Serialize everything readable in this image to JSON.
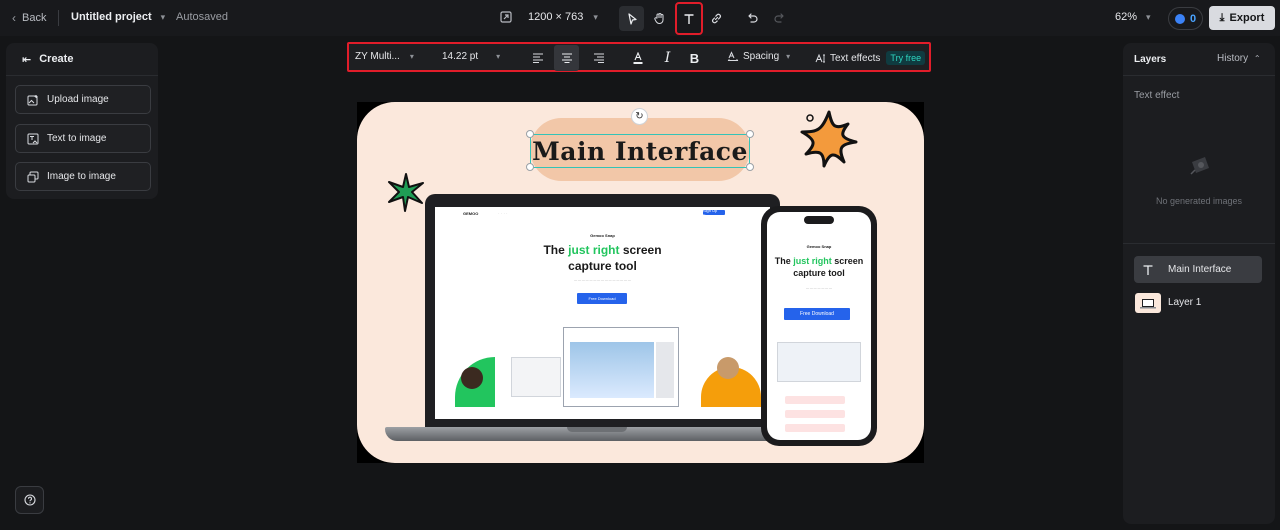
{
  "topbar": {
    "back_label": "Back",
    "project_name": "Untitled project",
    "autosaved": "Autosaved",
    "canvas_size": "1200 × 763",
    "zoom": "62%",
    "credits": "0",
    "export_label": "Export"
  },
  "left_panel": {
    "title": "Create",
    "buttons": [
      {
        "label": "Upload image"
      },
      {
        "label": "Text to image"
      },
      {
        "label": "Image to image"
      }
    ]
  },
  "text_toolbar": {
    "font": "ZY Multi...",
    "font_size": "14.22 pt",
    "spacing_label": "Spacing",
    "text_effects_label": "Text effects",
    "try_free": "Try free"
  },
  "canvas": {
    "title_text": "Main Interface",
    "laptop_site": {
      "brand": "Gemoo Snap",
      "headline_1": "The",
      "headline_highlight": "just right",
      "headline_2": "screen",
      "headline_3": "capture tool",
      "cta": "Free Download",
      "nav_logo": "GEMOO",
      "nav_cta": "Sign Up Free"
    },
    "phone_site": {
      "brand": "Gemoo Snap",
      "headline_1": "The",
      "headline_highlight": "just right",
      "headline_2": "screen",
      "headline_3": "capture tool",
      "cta": "Free Download"
    }
  },
  "right_panel": {
    "tab_layers": "Layers",
    "tab_history": "History",
    "section_label": "Text effect",
    "empty_text": "No generated images",
    "layers": [
      {
        "name": "Main Interface",
        "active": true
      },
      {
        "name": "Layer 1",
        "active": false
      }
    ]
  }
}
